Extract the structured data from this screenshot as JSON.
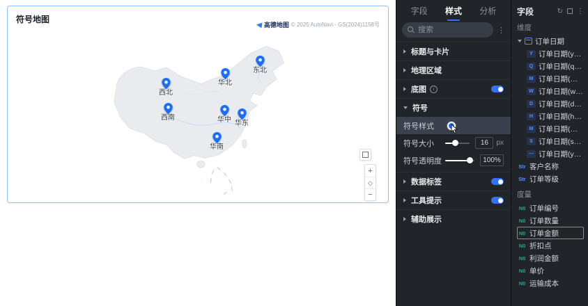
{
  "canvas": {
    "chart_title": "符号地图",
    "attribution": {
      "brand": "高德地图",
      "text": "© 2025 AutoNavi - GS(2024)1158号"
    },
    "regions": [
      {
        "name": "东北"
      },
      {
        "name": "华北"
      },
      {
        "name": "西北"
      },
      {
        "name": "西南"
      },
      {
        "name": "华中"
      },
      {
        "name": "华东"
      },
      {
        "name": "华南"
      }
    ],
    "pin_color": "#1a6dff",
    "controls": {
      "zoom_in": "+",
      "zoom_out": "−",
      "locate": "◇"
    }
  },
  "style_panel": {
    "tabs": [
      {
        "label": "字段"
      },
      {
        "label": "样式"
      },
      {
        "label": "分析"
      }
    ],
    "search_placeholder": "搜索",
    "more_icon": "⋮",
    "sections": {
      "title_card": "标题与卡片",
      "geo_area": "地理区域",
      "basemap": "底图",
      "basemap_info": "i",
      "symbol": "符号",
      "data_label": "数据标签",
      "tooltip": "工具提示",
      "aux_display": "辅助展示"
    },
    "symbol": {
      "style_label": "符号样式",
      "style_color": "#1a6dff",
      "size_label": "符号大小",
      "size_value": "16",
      "size_unit": "px",
      "opacity_label": "符号透明度",
      "opacity_value": "100%"
    }
  },
  "fields_panel": {
    "title": "字段",
    "icons": {
      "refresh": "↻",
      "more": "⋮"
    },
    "dimension_label": "维度",
    "measure_label": "度量",
    "date_group": "订单日期",
    "date_children": [
      {
        "badge": "Y",
        "label": "订单日期(year)"
      },
      {
        "badge": "Q",
        "label": "订单日期(quarter)"
      },
      {
        "badge": "M",
        "label": "订单日期(month)"
      },
      {
        "badge": "W",
        "label": "订单日期(week)"
      },
      {
        "badge": "D",
        "label": "订单日期(day)"
      },
      {
        "badge": "H",
        "label": "订单日期(hour)"
      },
      {
        "badge": "M",
        "label": "订单日期(minute)"
      },
      {
        "badge": "S",
        "label": "订单日期(second)"
      },
      {
        "badge": "⋯",
        "label": "订单日期(ymdhms)"
      }
    ],
    "string_dims": [
      {
        "badge": "Str",
        "label": "客户名称"
      },
      {
        "badge": "Str",
        "label": "订单等级"
      }
    ],
    "measures": [
      {
        "badge": "N0",
        "label": "订单编号"
      },
      {
        "badge": "N0",
        "label": "订单数量"
      },
      {
        "badge": "N0",
        "label": "订单金额"
      },
      {
        "badge": "N0",
        "label": "折扣点"
      },
      {
        "badge": "N0",
        "label": "利润金额"
      },
      {
        "badge": "N0",
        "label": "单价"
      },
      {
        "badge": "N0",
        "label": "运输成本"
      }
    ]
  }
}
